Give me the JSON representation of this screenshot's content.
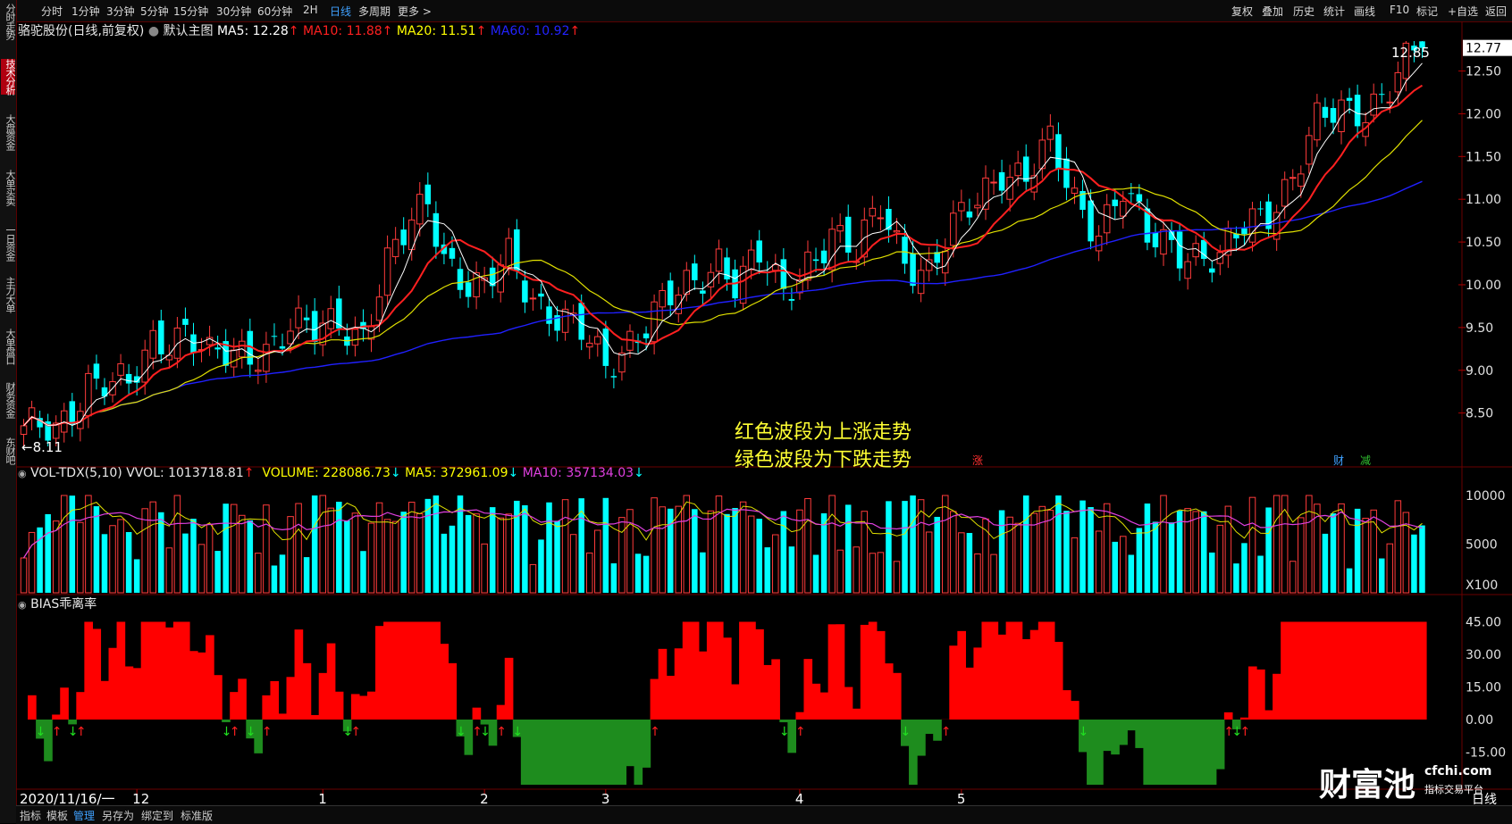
{
  "toolbar": {
    "periods": [
      "分时",
      "1分钟",
      "3分钟",
      "5分钟",
      "15分钟",
      "30分钟",
      "60分钟",
      "2H",
      "日线",
      "多周期",
      "更多"
    ],
    "selected": "日线",
    "tools": [
      "复权",
      "叠加",
      "历史",
      "统计",
      "画线",
      "F10",
      "标记",
      "+自选",
      "返回"
    ]
  },
  "side_tabs": [
    "分时走势",
    "技术分析",
    "大盘资金",
    "大单买卖",
    "一日资金",
    "主力大单",
    "大单盘口",
    "财务资金",
    "东财吧"
  ],
  "side_active": "技术分析",
  "main_panel": {
    "title": "骆驼股份(日线,前复权)",
    "template": "默认主图",
    "ma5": "MA5: 12.28",
    "ma10": "MA10: 11.88",
    "ma20": "MA20: 11.51",
    "ma60": "MA60: 10.92",
    "arrow": "↑",
    "high_label": "12.85",
    "low_label": "8.11",
    "current_price_tag": "12.77",
    "markers": [
      "涨",
      "财",
      "减"
    ]
  },
  "annotation": {
    "line1": "红色波段为上涨走势",
    "line2": "绿色波段为下跌走势"
  },
  "volume_panel": {
    "title": "VOL-TDX(5,10)",
    "vvol": "VVOL: 1013718.81",
    "volume": "VOLUME: 228086.73",
    "ma5": "MA5: 372961.09",
    "ma10": "MA10: 357134.03",
    "unit": "X100"
  },
  "bias_panel": {
    "title": "BIAS乖离率"
  },
  "x_axis": {
    "start": "2020/11/16/一",
    "ticks": [
      "12",
      "1",
      "2",
      "3",
      "4",
      "5"
    ],
    "period_label": "日线"
  },
  "bottom_tabs": [
    "指标",
    "模板",
    "管理",
    "另存为",
    "绑定到",
    "标准版"
  ],
  "bottom_selected": "管理",
  "watermark": {
    "brand": "财富池",
    "site": "cfchi.com",
    "tagline": "指标交易平台"
  },
  "chart_data": [
    {
      "type": "candlestick",
      "name": "price",
      "ylim": [
        8.11,
        12.85
      ],
      "y_ticks": [
        8.5,
        9.0,
        9.5,
        10.0,
        10.5,
        11.0,
        11.5,
        12.0,
        12.5,
        12.77
      ],
      "x_ticks": [
        {
          "label": "12",
          "index": 14
        },
        {
          "label": "1",
          "index": 37
        },
        {
          "label": "2",
          "index": 57
        },
        {
          "label": "3",
          "index": 72
        },
        {
          "label": "4",
          "index": 96
        },
        {
          "label": "5",
          "index": 116
        }
      ],
      "colors": {
        "up": "#ff3b3b",
        "down": "#00ffff",
        "ma5": "#ffffff",
        "ma10": "#ff2020",
        "ma20": "#e0e000",
        "ma60": "#2020ff"
      },
      "key_prices": [
        8.11,
        8.2,
        8.3,
        8.4,
        8.5,
        8.6,
        8.7,
        8.8,
        8.9,
        9.0,
        9.1,
        9.2,
        9.3,
        9.4,
        9.5,
        9.6,
        9.7,
        9.8,
        9.9,
        10.0,
        10.1,
        10.2,
        10.3,
        10.4,
        10.5,
        10.6,
        10.7,
        10.8,
        10.9,
        11.0,
        11.1,
        11.2,
        11.3,
        11.4,
        11.5,
        11.6,
        11.7,
        11.8,
        11.9,
        12.0,
        12.1,
        12.2,
        12.3,
        12.4,
        12.5,
        12.6,
        12.7,
        12.77,
        12.85
      ],
      "anchors": [
        [
          0,
          8.25
        ],
        [
          4,
          8.3
        ],
        [
          8,
          8.9
        ],
        [
          13,
          8.75
        ],
        [
          16,
          9.35
        ],
        [
          20,
          9.5
        ],
        [
          23,
          9.1
        ],
        [
          26,
          9.15
        ],
        [
          30,
          9.3
        ],
        [
          33,
          9.5
        ],
        [
          36,
          9.4
        ],
        [
          39,
          9.6
        ],
        [
          42,
          9.45
        ],
        [
          45,
          10.2
        ],
        [
          50,
          11.0
        ],
        [
          52,
          10.4
        ],
        [
          55,
          10.0
        ],
        [
          57,
          9.9
        ],
        [
          60,
          10.3
        ],
        [
          63,
          9.9
        ],
        [
          66,
          9.65
        ],
        [
          69,
          9.4
        ],
        [
          72,
          9.0
        ],
        [
          75,
          9.4
        ],
        [
          78,
          9.7
        ],
        [
          83,
          9.95
        ],
        [
          86,
          10.35
        ],
        [
          88,
          10.1
        ],
        [
          91,
          10.3
        ],
        [
          94,
          9.8
        ],
        [
          97,
          10.3
        ],
        [
          100,
          10.65
        ],
        [
          103,
          10.3
        ],
        [
          106,
          10.9
        ],
        [
          109,
          10.35
        ],
        [
          112,
          10.15
        ],
        [
          115,
          10.6
        ],
        [
          118,
          11.0
        ],
        [
          121,
          11.4
        ],
        [
          124,
          11.25
        ],
        [
          127,
          11.6
        ],
        [
          130,
          11.0
        ],
        [
          133,
          10.7
        ],
        [
          136,
          11.1
        ],
        [
          139,
          10.5
        ],
        [
          142,
          10.5
        ],
        [
          145,
          10.4
        ],
        [
          148,
          10.25
        ],
        [
          151,
          10.65
        ],
        [
          154,
          10.9
        ],
        [
          157,
          11.3
        ],
        [
          160,
          11.85
        ],
        [
          163,
          12.0
        ],
        [
          166,
          12.1
        ],
        [
          169,
          12.35
        ],
        [
          173,
          12.77
        ]
      ],
      "candle_count": 174
    },
    {
      "type": "bar",
      "name": "volume",
      "y_ticks": [
        5000,
        10000
      ],
      "ylim": [
        0,
        10000
      ]
    },
    {
      "type": "area",
      "name": "bias",
      "y_ticks": [
        -15.0,
        0.0,
        15.0,
        30.0,
        45.0
      ],
      "ylim": [
        -32,
        48
      ],
      "up_color": "#ff0000",
      "down_color": "#1e8c1e"
    }
  ]
}
